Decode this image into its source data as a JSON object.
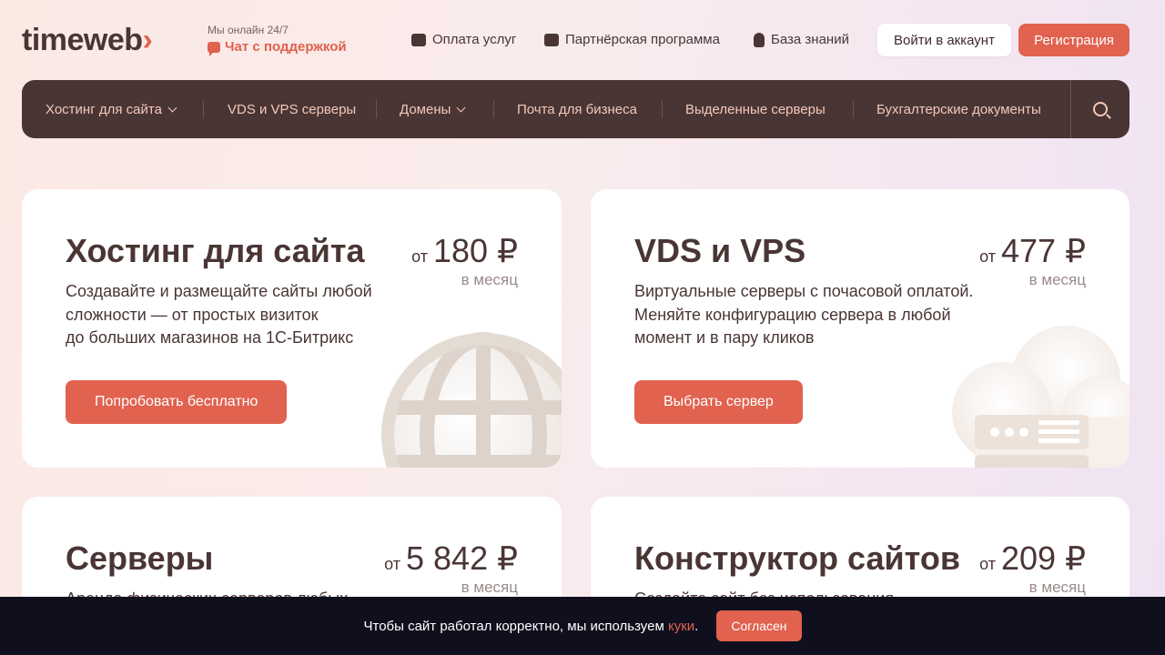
{
  "header": {
    "logo": {
      "text": "timeweb",
      "arrow": "›"
    },
    "support": {
      "online_text": "Мы онлайн 24/7",
      "chat_label": "Чат с поддержкой"
    },
    "links": [
      {
        "label": "Оплата услуг",
        "icon": "wallet-icon"
      },
      {
        "label": "Партнёрская программа",
        "icon": "ticket-icon"
      },
      {
        "label": "База знаний",
        "icon": "bulb-icon"
      }
    ],
    "login_label": "Войти в аккаунт",
    "register_label": "Регистрация"
  },
  "nav": {
    "items": [
      {
        "label": "Хостинг для сайта",
        "dropdown": true
      },
      {
        "label": "VDS и VPS серверы",
        "dropdown": false
      },
      {
        "label": "Домены",
        "dropdown": true
      },
      {
        "label": "Почта для бизнеса",
        "dropdown": false
      },
      {
        "label": "Выделенные серверы",
        "dropdown": false
      },
      {
        "label": "Бухгалтерские документы",
        "dropdown": false
      }
    ],
    "search_icon": "search-icon"
  },
  "cards": [
    {
      "title": "Хостинг для сайта",
      "price_prefix": "от",
      "price": "180 ₽",
      "period": "в месяц",
      "desc": [
        "Создавайте и размещайте сайты любой",
        "сложности — от простых визиток",
        "до больших магазинов на 1С-Битрикс"
      ],
      "cta": "Попробовать бесплатно"
    },
    {
      "title": "VDS и VPS",
      "price_prefix": "от",
      "price": "477 ₽",
      "period": "в месяц",
      "desc": [
        "Виртуальные серверы с почасовой оплатой.",
        "Меняйте конфигурацию сервера в любой",
        "момент и в пару кликов"
      ],
      "cta": "Выбрать сервер"
    },
    {
      "title": "Серверы",
      "price_prefix": "от",
      "price": "5 842 ₽",
      "period": "в месяц",
      "desc": [
        "Аренда физических серверов любых"
      ]
    },
    {
      "title": "Конструктор сайтов",
      "price_prefix": "от",
      "price": "209 ₽",
      "period": "в месяц",
      "desc": [
        "Создайте сайт без использования"
      ]
    }
  ],
  "cookie": {
    "text_before": "Чтобы сайт работал корректно, мы используем ",
    "link": "куки",
    "text_after": ".",
    "accept_label": "Согласен"
  },
  "colors": {
    "accent": "#e0624f",
    "dark": "#4a3535",
    "nav_text": "#f3c9b8",
    "cookie_bg": "#0f0f1e"
  }
}
